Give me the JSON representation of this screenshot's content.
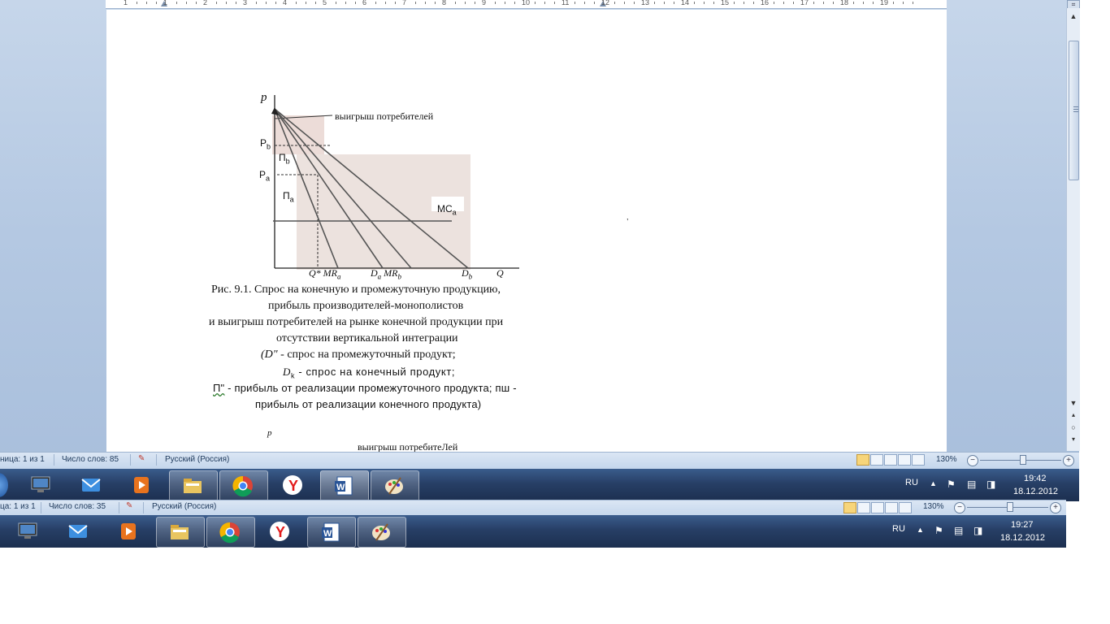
{
  "window": {
    "ruler_numbers": [
      "1",
      "1",
      "2",
      "3",
      "4",
      "5",
      "6",
      "7",
      "8",
      "9",
      "10",
      "11",
      "12",
      "13",
      "14",
      "15",
      "16",
      "17",
      "18",
      "19"
    ]
  },
  "figure": {
    "axis_p": "p",
    "label_consumer_surplus": "выигрыш потребителей",
    "label_pb_main": "P",
    "label_pb_sub": "b",
    "label_pa_main": "P",
    "label_pa_sub": "a",
    "label_pib_main": "П",
    "label_pib_sub": "b",
    "label_pia_main": "П",
    "label_pia_sub": "a",
    "label_mca_main": "MC",
    "label_mca_sub": "a",
    "x_q_star": "Q* ",
    "x_mr_a_main": "MR",
    "x_mr_a_sub": "a",
    "x_d_a_main": "D",
    "x_d_a_sub": "a",
    "x_mr_b_main": "MR",
    "x_mr_b_sub": "b",
    "x_d_b_main": "D",
    "x_d_b_sub": "b",
    "x_q": "Q"
  },
  "caption": {
    "line1": "Рис. 9.1. Спрос на конечную и промежуточную  продукцию,",
    "line2": "прибыль производителей-монополистов",
    "line3": "и выигрыш потребителей  на рынке конечной продукции при",
    "line4": "отсутствии вертикальной  интеграции",
    "line5_italic": "(D\"",
    "line5_rest": " - спрос на промежуточный продукт;",
    "line6_italic": "D",
    "line6_sub": "k",
    "line6_rest": " - спрос  на  конечный  продукт;",
    "line7_start": "П\"",
    "line7_rest": " - прибыль  от реализации  промежуточного  продукта;  пш -",
    "line8": "прибыль от реализации конечного продукта)",
    "after_p": "p",
    "after_text": "выигрыш потребитеЛей"
  },
  "statusbar_top": {
    "page": "ница: 1 из 1",
    "words": "Число слов: 85",
    "language": "Русский (Россия)",
    "zoom": "130%"
  },
  "statusbar_bottom": {
    "page": "ца: 1 из 1",
    "words": "Число слов: 35",
    "language": "Русский (Россия)",
    "zoom": "130%"
  },
  "taskbar_top": {
    "lang": "RU",
    "time": "19:42",
    "date": "18.12.2012"
  },
  "taskbar_bottom": {
    "lang": "RU",
    "time": "19:27",
    "date": "18.12.2012"
  },
  "icons": [
    "windows-orb-icon",
    "monitor-icon",
    "mail-icon",
    "media-player-icon",
    "file-explorer-icon",
    "chrome-icon",
    "yandex-icon",
    "word-icon",
    "paint-icon",
    "flag-icon",
    "network-icon",
    "volume-icon",
    "arrow-up-icon"
  ]
}
